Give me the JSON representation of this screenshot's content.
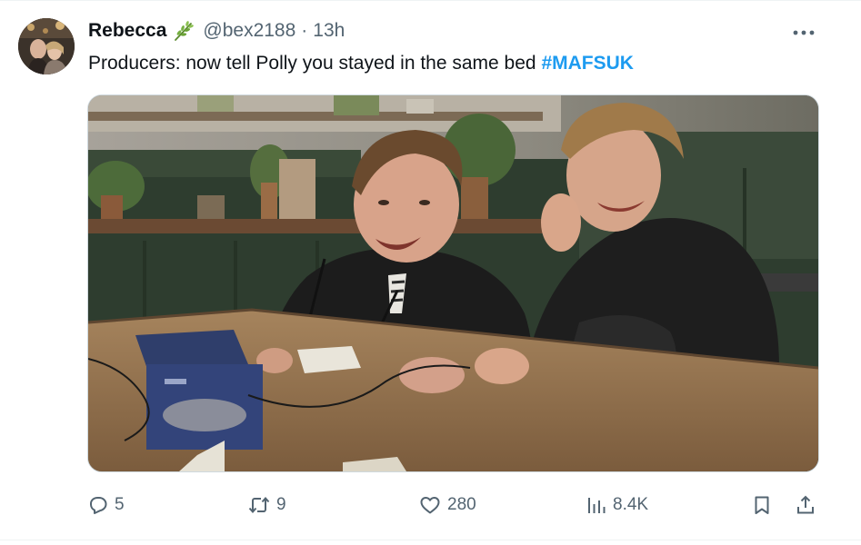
{
  "tweet": {
    "author_name": "Rebecca",
    "handle": "@bex2188",
    "separator": "·",
    "timestamp": "13h",
    "text_prefix": "Producers: now tell Polly you stayed in the same bed ",
    "hashtag": "#MAFSUK",
    "author_badge_icon": "herb-emoji",
    "media_description_icon": "video-thumbnail"
  },
  "actions": {
    "replies": "5",
    "reposts": "9",
    "likes": "280",
    "views": "8.4K"
  },
  "colors": {
    "accent": "#1d9bf0",
    "secondary_text": "#536471",
    "primary_text": "#0f1419",
    "divider": "#eff3f4"
  }
}
